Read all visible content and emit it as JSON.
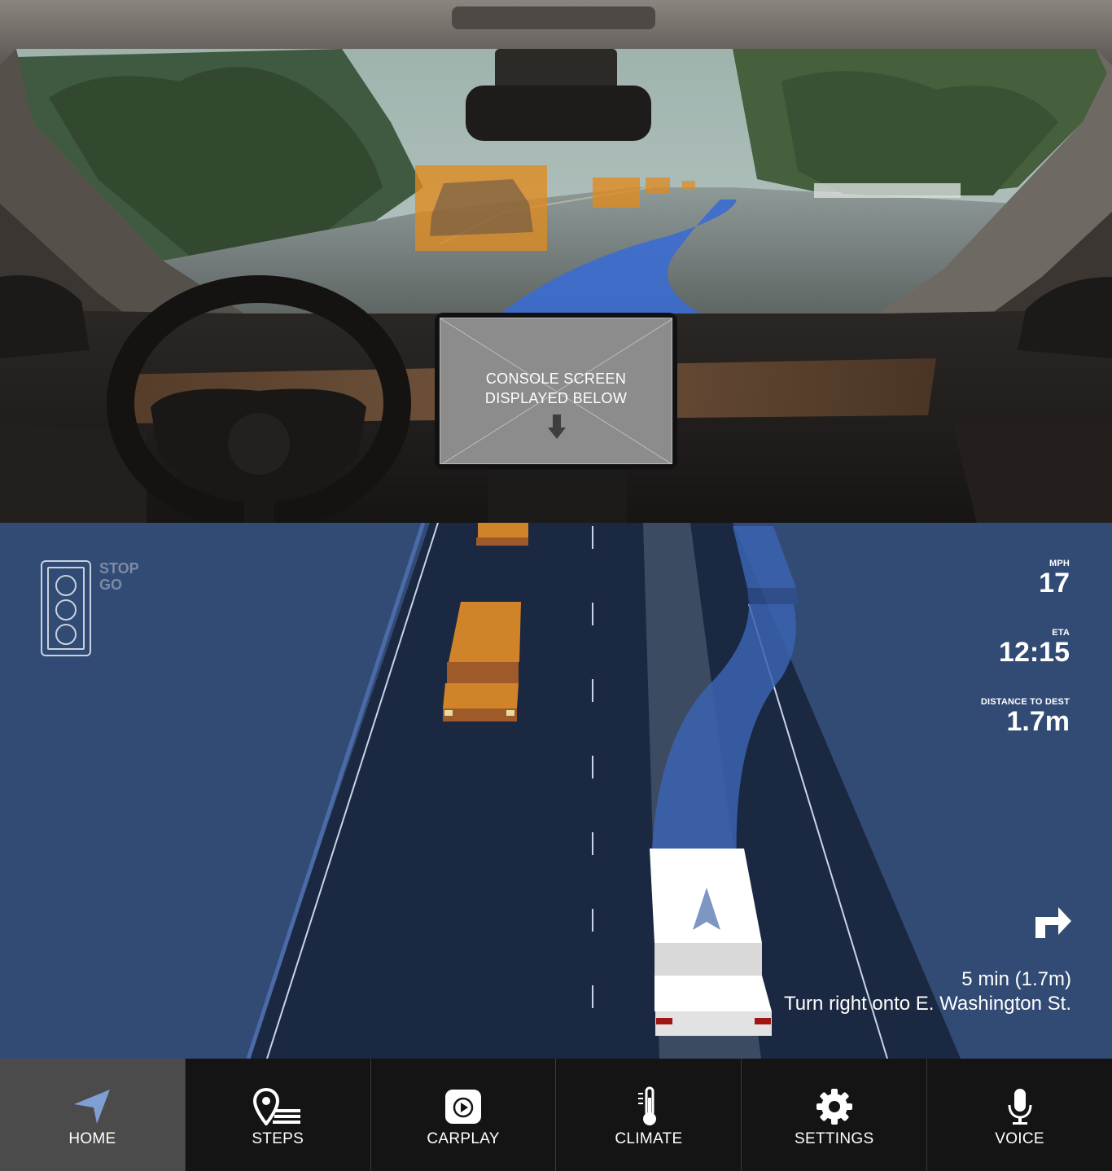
{
  "console_screen": {
    "line1": "CONSOLE SCREEN",
    "line2": "DISPLAYED BELOW"
  },
  "traffic_light": {
    "stop": "STOP",
    "go": "GO"
  },
  "stats": {
    "speed_label": "MPH",
    "speed_value": "17",
    "eta_label": "ETA",
    "eta_value": "12:15",
    "distance_label": "DISTANCE TO DEST",
    "distance_value": "1.7m"
  },
  "directions": {
    "summary": "5 min (1.7m)",
    "instruction": "Turn right onto E. Washington St.",
    "turn_icon": "turn-right-icon"
  },
  "nav": {
    "items": [
      {
        "label": "HOME",
        "icon": "navigation-arrow-icon",
        "active": true
      },
      {
        "label": "STEPS",
        "icon": "map-pin-list-icon",
        "active": false
      },
      {
        "label": "CARPLAY",
        "icon": "carplay-icon",
        "active": false
      },
      {
        "label": "CLIMATE",
        "icon": "thermometer-icon",
        "active": false
      },
      {
        "label": "SETTINGS",
        "icon": "gear-icon",
        "active": false
      },
      {
        "label": "VOICE",
        "icon": "microphone-icon",
        "active": false
      }
    ]
  },
  "colors": {
    "nav_background": "#324b74",
    "road": "#1b2841",
    "vehicle_highlight": "#e08a1e",
    "route_path": "#3a63b0",
    "navbar": "#141414",
    "navbar_active": "#4b4b4b"
  }
}
